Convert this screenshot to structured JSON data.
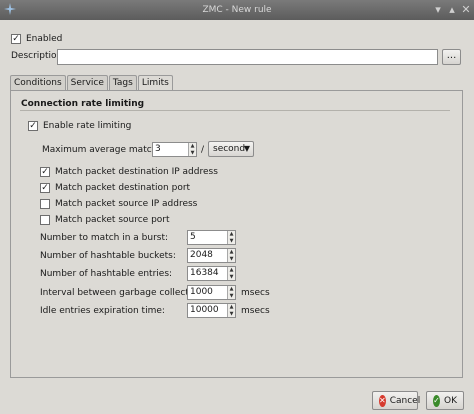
{
  "window": {
    "title": "ZMC - New rule"
  },
  "general": {
    "enabled_label": "Enabled",
    "enabled_checked": true,
    "description_label": "Description:",
    "description_value": "",
    "browse_label": "..."
  },
  "tabs": [
    {
      "label": "Conditions",
      "active": false
    },
    {
      "label": "Service",
      "active": false
    },
    {
      "label": "Tags",
      "active": false
    },
    {
      "label": "Limits",
      "active": true
    }
  ],
  "limits": {
    "section_title": "Connection rate limiting",
    "enable_label": "Enable rate limiting",
    "enable_checked": true,
    "max_rate_label": "Maximum average match rate:",
    "max_rate_value": "3",
    "slash": "/",
    "unit_value": "second",
    "options": [
      {
        "label": "Match packet destination IP address",
        "checked": true
      },
      {
        "label": "Match packet destination port",
        "checked": true
      },
      {
        "label": "Match packet source IP address",
        "checked": false
      },
      {
        "label": "Match packet source port",
        "checked": false
      }
    ],
    "burst_label": "Number to match in a burst:",
    "burst_value": "5",
    "buckets_label": "Number of hashtable buckets:",
    "buckets_value": "2048",
    "entries_label": "Number of hashtable entries:",
    "entries_value": "16384",
    "gc_label": "Interval between garbage collection runs:",
    "gc_value": "1000",
    "gc_unit": "msecs",
    "idle_label": "Idle entries expiration time:",
    "idle_value": "10000",
    "idle_unit": "msecs"
  },
  "buttons": {
    "cancel": "Cancel",
    "ok": "OK"
  }
}
